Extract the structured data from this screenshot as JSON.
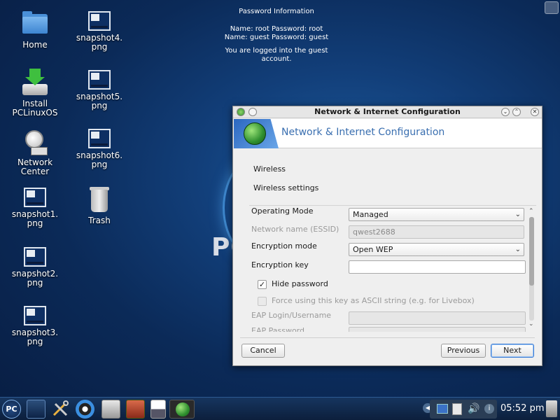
{
  "desktop": {
    "icons": [
      {
        "label": "Home"
      },
      {
        "label": "Install\nPCLinuxOS"
      },
      {
        "label": "Network\nCenter"
      },
      {
        "label": "snapshot1.\npng"
      },
      {
        "label": "snapshot2.\npng"
      },
      {
        "label": "snapshot3.\npng"
      },
      {
        "label": "snapshot4.\npng"
      },
      {
        "label": "snapshot5.\npng"
      },
      {
        "label": "snapshot6.\npng"
      },
      {
        "label": "Trash"
      }
    ],
    "bg_logo": "PC",
    "password_info": {
      "title": "Password Information",
      "line1": "Name: root  Password: root",
      "line2": "Name: guest Password: guest",
      "line3": "You are logged into the guest account."
    }
  },
  "dialog": {
    "window_title": "Network & Internet Configuration",
    "header_title": "Network & Internet Configuration",
    "section_wireless": "Wireless",
    "section_settings": "Wireless settings",
    "operating_mode": {
      "label": "Operating Mode",
      "value": "Managed"
    },
    "network_name": {
      "label": "Network name (ESSID)",
      "value": "qwest2688"
    },
    "encryption_mode": {
      "label": "Encryption mode",
      "value": "Open WEP"
    },
    "encryption_key": {
      "label": "Encryption key",
      "value": ""
    },
    "hide_password": {
      "label": "Hide password",
      "checked": true
    },
    "force_ascii": {
      "label": "Force using this key as ASCII string (e.g. for Livebox)",
      "checked": false
    },
    "eap_login": {
      "label": "EAP Login/Username",
      "value": ""
    },
    "eap_password": {
      "label": "EAP Password",
      "value": ""
    },
    "buttons": {
      "cancel": "Cancel",
      "previous": "Previous",
      "next": "Next"
    }
  },
  "taskbar": {
    "launcher_label": "PC",
    "clock": "05:52 pm"
  },
  "colors": {
    "accent": "#3c7dd6",
    "header_title": "#3a6fb0"
  }
}
